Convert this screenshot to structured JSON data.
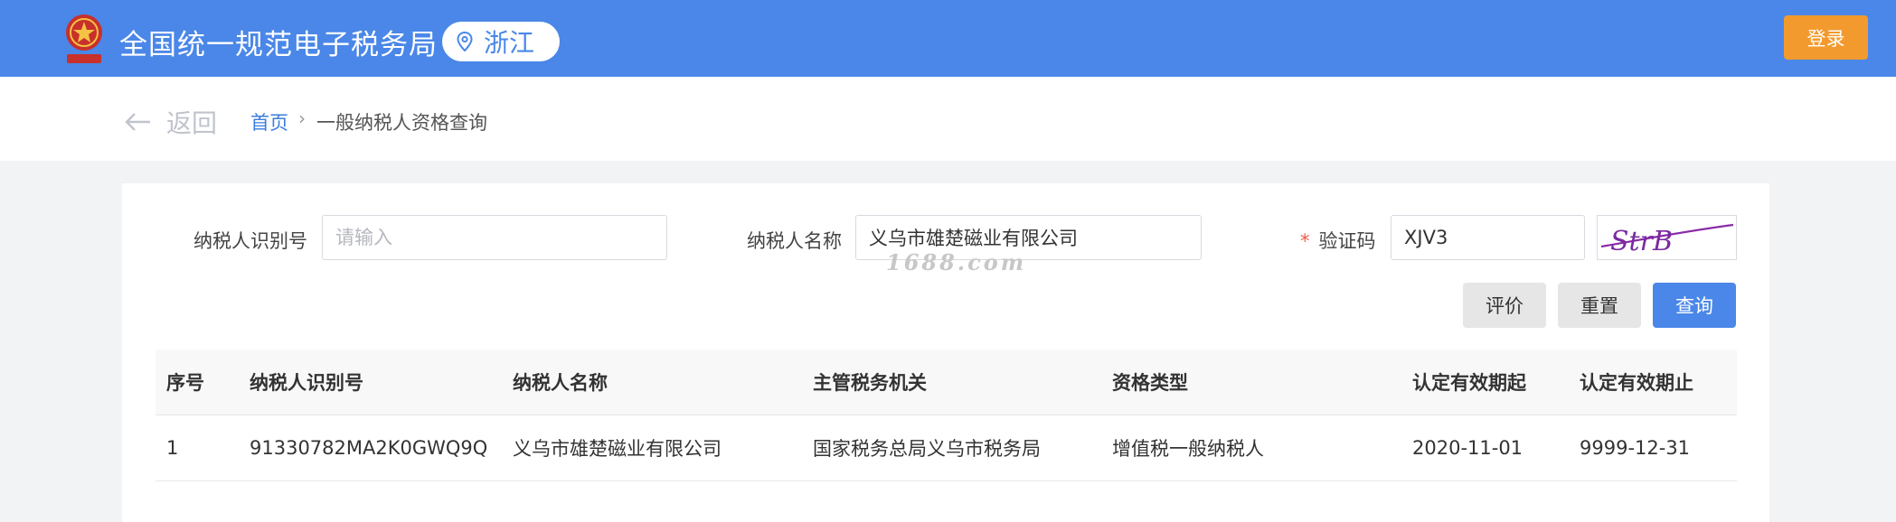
{
  "header": {
    "site_title": "全国统一规范电子税务局",
    "region": "浙江",
    "login_label": "登录",
    "emblem_icon": "tax-emblem-icon",
    "region_icon": "location-pin-icon",
    "bar_color": "#4a87e8",
    "login_color": "#f39a2e"
  },
  "breadcrumb": {
    "back_label": "返回",
    "back_icon": "arrow-left-icon",
    "home": "首页",
    "separator": "›",
    "current": "一般纳税人资格查询"
  },
  "form": {
    "taxpayer_id": {
      "label": "纳税人识别号",
      "value": "",
      "placeholder": "请输入"
    },
    "taxpayer_name": {
      "label": "纳税人名称",
      "value": "义乌市雄楚磁业有限公司"
    },
    "captcha": {
      "label": "验证码",
      "required_mark": "*",
      "value": "XJV3",
      "image_text": "StrB"
    },
    "buttons": {
      "evaluate": "评价",
      "reset": "重置",
      "query": "查询"
    }
  },
  "results": {
    "columns": [
      "序号",
      "纳税人识别号",
      "纳税人名称",
      "主管税务机关",
      "资格类型",
      "认定有效期起",
      "认定有效期止"
    ],
    "rows": [
      [
        "1",
        "91330782MA2K0GWQ9Q",
        "义乌市雄楚磁业有限公司",
        "国家税务总局义乌市税务局",
        "增值税一般纳税人",
        "2020-11-01",
        "9999-12-31"
      ]
    ]
  },
  "watermark": "1688.com",
  "colors": {
    "accent": "#4a87e8",
    "required": "#f05a4a"
  }
}
